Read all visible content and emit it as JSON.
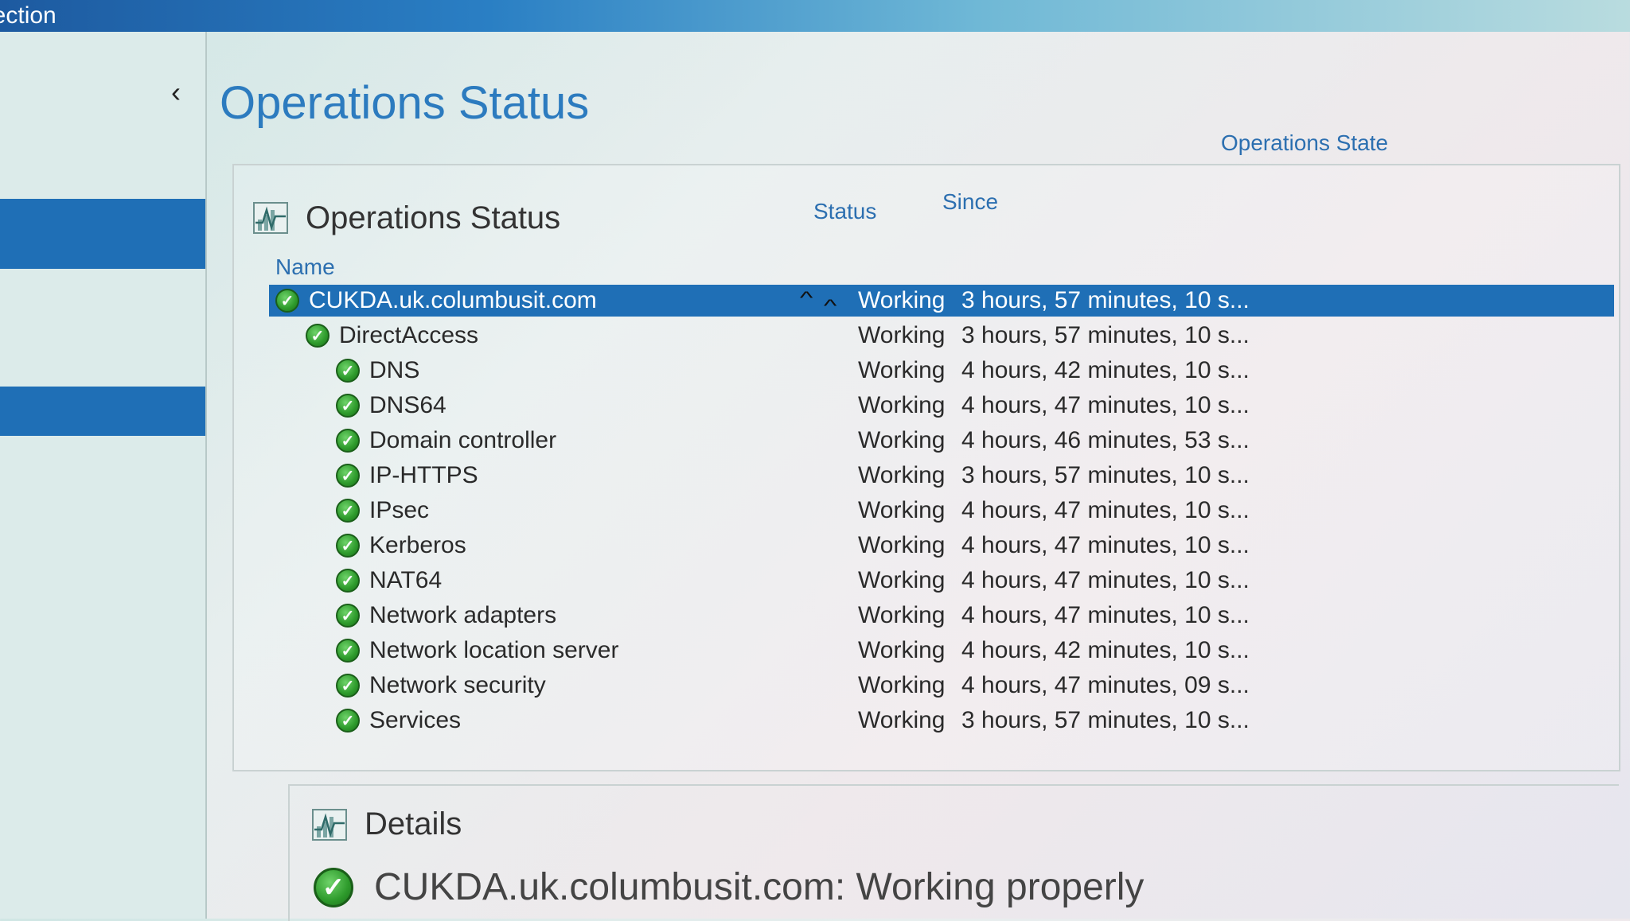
{
  "window": {
    "title_fragment": "nection"
  },
  "colors": {
    "accent": "#1f6fb6",
    "title_blue": "#2c7bbf",
    "check_green": "#2d9a2b"
  },
  "page": {
    "title": "Operations Status"
  },
  "panel": {
    "title": "Operations Status",
    "icon": "pulse-chart-icon",
    "columns": {
      "name": "Name",
      "status": "Status",
      "since": "Since",
      "opstate": "Operations State"
    },
    "rows": [
      {
        "name": "CUKDA.uk.columbusit.com",
        "status": "Working",
        "since": "3 hours, 57 minutes, 10 s...",
        "level": 0,
        "selected": true
      },
      {
        "name": "DirectAccess",
        "status": "Working",
        "since": "3 hours, 57 minutes, 10 s...",
        "level": 1
      },
      {
        "name": "DNS",
        "status": "Working",
        "since": "4 hours, 42 minutes, 10 s...",
        "level": 2
      },
      {
        "name": "DNS64",
        "status": "Working",
        "since": "4 hours, 47 minutes, 10 s...",
        "level": 2
      },
      {
        "name": "Domain controller",
        "status": "Working",
        "since": "4 hours, 46 minutes, 53 s...",
        "level": 2
      },
      {
        "name": "IP-HTTPS",
        "status": "Working",
        "since": "3 hours, 57 minutes, 10 s...",
        "level": 2
      },
      {
        "name": "IPsec",
        "status": "Working",
        "since": "4 hours, 47 minutes, 10 s...",
        "level": 2
      },
      {
        "name": "Kerberos",
        "status": "Working",
        "since": "4 hours, 47 minutes, 10 s...",
        "level": 2
      },
      {
        "name": "NAT64",
        "status": "Working",
        "since": "4 hours, 47 minutes, 10 s...",
        "level": 2
      },
      {
        "name": "Network adapters",
        "status": "Working",
        "since": "4 hours, 47 minutes, 10 s...",
        "level": 2
      },
      {
        "name": "Network location server",
        "status": "Working",
        "since": "4 hours, 42 minutes, 10 s...",
        "level": 2
      },
      {
        "name": "Network security",
        "status": "Working",
        "since": "4 hours, 47 minutes, 09 s...",
        "level": 2
      },
      {
        "name": "Services",
        "status": "Working",
        "since": "3 hours, 57 minutes, 10 s...",
        "level": 2
      }
    ]
  },
  "details": {
    "title": "Details",
    "message": "CUKDA.uk.columbusit.com: Working properly"
  }
}
